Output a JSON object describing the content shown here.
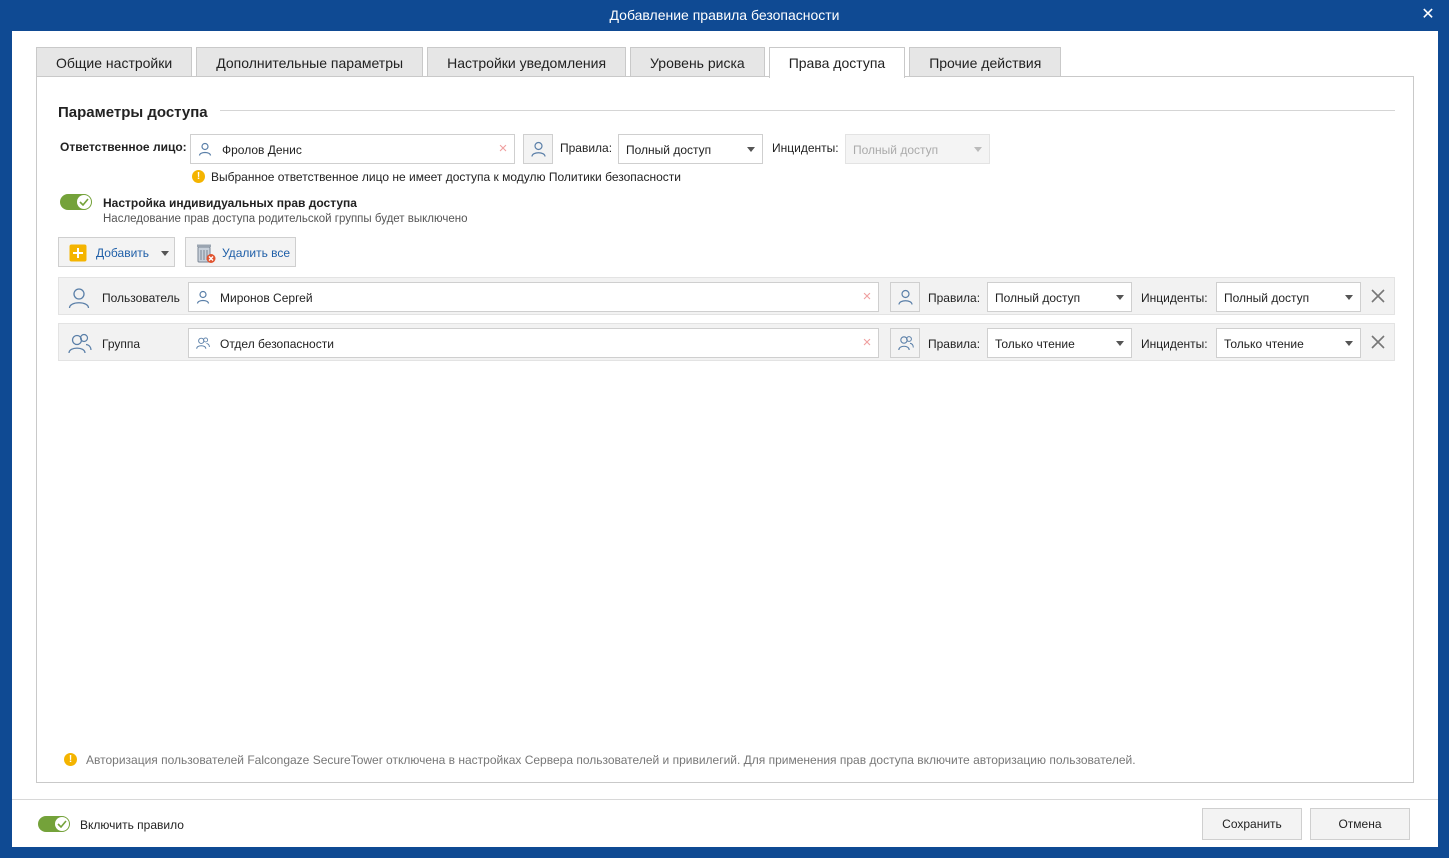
{
  "window": {
    "title": "Добавление правила безопасности",
    "close_glyph": "✕"
  },
  "tabs": [
    {
      "label": "Общие настройки",
      "active": false
    },
    {
      "label": "Дополнительные параметры",
      "active": false
    },
    {
      "label": "Настройки уведомления",
      "active": false
    },
    {
      "label": "Уровень риска",
      "active": false
    },
    {
      "label": "Права доступа",
      "active": true
    },
    {
      "label": "Прочие действия",
      "active": false
    }
  ],
  "access": {
    "section_title": "Параметры доступа",
    "responsible_label": "Ответственное лицо:",
    "responsible_value": "Фролов Денис",
    "rules_label": "Правила:",
    "rules_value": "Полный доступ",
    "incidents_label": "Инциденты:",
    "incidents_value": "Полный доступ",
    "warning": "Выбранное ответственное лицо не имеет доступа к модулю Политики безопасности",
    "individual_toggle_label": "Настройка индивидуальных прав доступа",
    "individual_toggle_on": true,
    "individual_toggle_hint": "Наследование прав доступа родительской группы будет выключено"
  },
  "toolbar": {
    "add_label": "Добавить",
    "delete_all_label": "Удалить все"
  },
  "entries": [
    {
      "type_label": "Пользователь",
      "icon": "user-icon",
      "name": "Миронов Сергей",
      "rules_label": "Правила:",
      "rules_value": "Полный доступ",
      "incidents_label": "Инциденты:",
      "incidents_value": "Полный доступ"
    },
    {
      "type_label": "Группа",
      "icon": "group-icon",
      "name": "Отдел безопасности",
      "rules_label": "Правила:",
      "rules_value": "Только чтение",
      "incidents_label": "Инциденты:",
      "incidents_value": "Только чтение"
    }
  ],
  "bottom_note": "Авторизация пользователей Falcongaze SecureTower отключена в настройках Сервера пользователей и привилегий. Для применения прав доступа включите авторизацию пользователей.",
  "footer": {
    "enable_rule_label": "Включить правило",
    "enable_rule_on": true,
    "save_label": "Сохранить",
    "cancel_label": "Отмена"
  },
  "colors": {
    "titlebar": "#0f4a93",
    "toggle_on": "#74a23a",
    "warning": "#f4b400",
    "link": "#1f5fa8"
  }
}
